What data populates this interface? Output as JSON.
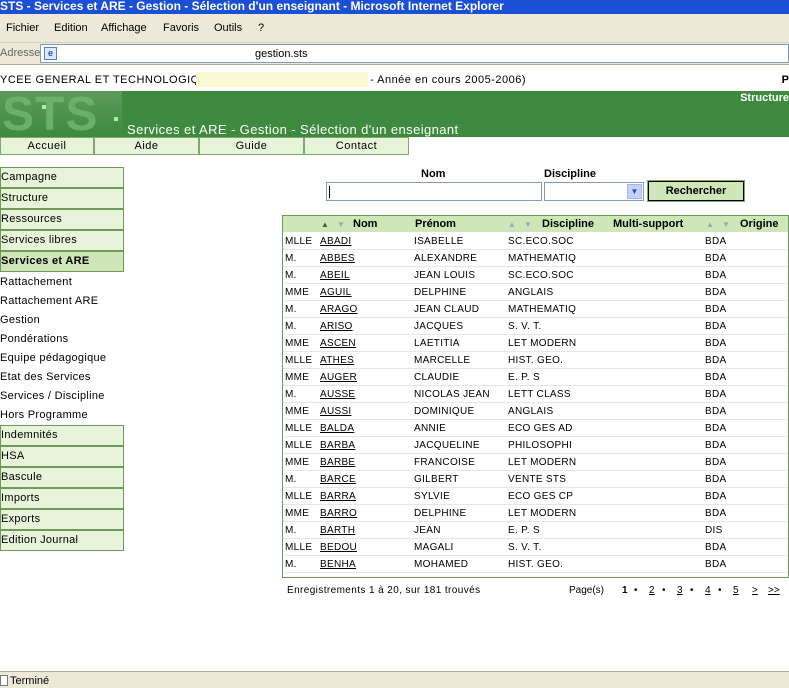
{
  "window": {
    "title": "STS - Services et ARE - Gestion - Sélection d'un enseignant - Microsoft Internet Explorer"
  },
  "menu": [
    "Fichier",
    "Edition",
    "Affichage",
    "Favoris",
    "Outils",
    "?"
  ],
  "address": {
    "label": "Adresse",
    "value": "gestion.sts"
  },
  "header": {
    "school": "YCEE GENERAL ET TECHNOLOGIQUE",
    "year": "- Année en cours 2005-2006)",
    "right_char": "P",
    "structure": "Structure",
    "logo": "STS",
    "title": "Services et ARE - Gestion - Sélection d'un enseignant"
  },
  "topnav": [
    "Accueil",
    "Aide",
    "Guide",
    "Contact"
  ],
  "sidebar": {
    "top": [
      "Campagne",
      "Structure",
      "Ressources",
      "Services libres",
      "Services et ARE"
    ],
    "sub": [
      "Rattachement",
      "Rattachement ARE",
      "Gestion",
      "Pondérations",
      "Equipe pédagogique",
      "Etat des Services",
      "Services / Discipline",
      "Hors Programme"
    ],
    "bottom": [
      "Indemnités",
      "HSA",
      "Bascule",
      "Imports",
      "Exports",
      "Edition Journal"
    ]
  },
  "search": {
    "nom_label": "Nom",
    "nom_value": "",
    "discipline_label": "Discipline",
    "discipline_value": "",
    "button": "Rechercher"
  },
  "table": {
    "headers": {
      "nom": "Nom",
      "prenom": "Prénom",
      "discipline": "Discipline",
      "multi": "Multi-support",
      "origine": "Origine"
    },
    "rows": [
      [
        "MLLE",
        "ABADI",
        "ISABELLE",
        "SC.ECO.SOC",
        "",
        "BDA"
      ],
      [
        "M.",
        "ABBES",
        "ALEXANDRE",
        "MATHEMATIQ",
        "",
        "BDA"
      ],
      [
        "M.",
        "ABEIL",
        "JEAN LOUIS",
        "SC.ECO.SOC",
        "",
        "BDA"
      ],
      [
        "MME",
        "AGUIL",
        "DELPHINE",
        "ANGLAIS",
        "",
        "BDA"
      ],
      [
        "M.",
        "ARAGO",
        "JEAN CLAUD",
        "MATHEMATIQ",
        "",
        "BDA"
      ],
      [
        "M.",
        "ARISO",
        "JACQUES",
        "S. V. T.",
        "",
        "BDA"
      ],
      [
        "MME",
        "ASCEN",
        "LAETITIA",
        "LET MODERN",
        "",
        "BDA"
      ],
      [
        "MLLE",
        "ATHES",
        "MARCELLE",
        "HIST. GEO.",
        "",
        "BDA"
      ],
      [
        "MME",
        "AUGER",
        "CLAUDIE",
        "E. P. S",
        "",
        "BDA"
      ],
      [
        "M.",
        "AUSSE",
        "NICOLAS JEAN",
        "LETT CLASS",
        "",
        "BDA"
      ],
      [
        "MME",
        "AUSSI",
        "DOMINIQUE",
        "ANGLAIS",
        "",
        "BDA"
      ],
      [
        "MLLE",
        "BALDA",
        "ANNIE",
        "ECO GES AD",
        "",
        "BDA"
      ],
      [
        "MLLE",
        "BARBA",
        "JACQUELINE",
        "PHILOSOPHI",
        "",
        "BDA"
      ],
      [
        "MME",
        "BARBE",
        "FRANCOISE",
        "LET MODERN",
        "",
        "BDA"
      ],
      [
        "M.",
        "BARCE",
        "GILBERT",
        "VENTE STS",
        "",
        "BDA"
      ],
      [
        "MLLE",
        "BARRA",
        "SYLVIE",
        "ECO GES CP",
        "",
        "BDA"
      ],
      [
        "MME",
        "BARRO",
        "DELPHINE",
        "LET MODERN",
        "",
        "BDA"
      ],
      [
        "M.",
        "BARTH",
        "JEAN",
        "E. P. S",
        "",
        "DIS"
      ],
      [
        "MLLE",
        "BEDOU",
        "MAGALI",
        "S. V. T.",
        "",
        "BDA"
      ],
      [
        "M.",
        "BENHA",
        "MOHAMED",
        "HIST. GEO.",
        "",
        "BDA"
      ]
    ]
  },
  "footer": {
    "count": "Enregistrements 1 à 20, sur 181 trouvés",
    "pages_label": "Page(s)",
    "pages": [
      "1",
      "2",
      "3",
      "4",
      "5"
    ],
    "next": ">",
    "last": ">>"
  },
  "status": {
    "text": "Terminé"
  }
}
